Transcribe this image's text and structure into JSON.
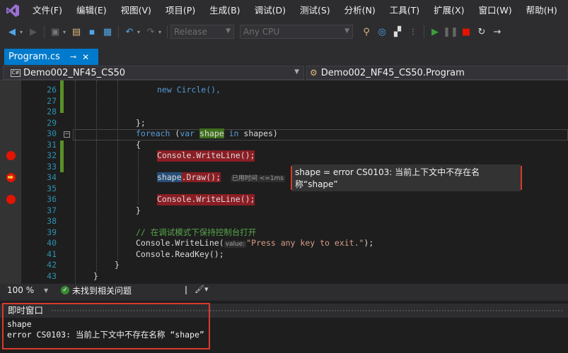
{
  "menubar": {
    "items": [
      "文件(F)",
      "编辑(E)",
      "视图(V)",
      "项目(P)",
      "生成(B)",
      "调试(D)",
      "测试(S)",
      "分析(N)",
      "工具(T)",
      "扩展(X)",
      "窗口(W)",
      "帮助(H)"
    ]
  },
  "toolbar": {
    "configuration": "Release",
    "platform": "Any CPU"
  },
  "tab": {
    "title": "Program.cs",
    "pin_icon": "pin-icon",
    "close_icon": "close-icon"
  },
  "navbar": {
    "project": "Demo002_NF45_CS50",
    "class": "Demo002_NF45_CS50.Program"
  },
  "editor": {
    "lines": {
      "l26": "new Circle(),",
      "l29": "};",
      "l30_kw1": "foreach",
      "l30_a": " (",
      "l30_kw2": "var",
      "l30_var": "shape",
      "l30_kw3": "in",
      "l30_b": " shapes)",
      "l31": "{",
      "l32": "Console.WriteLine();",
      "l34_var": "shape",
      "l34_call": ".Draw();",
      "l34_hint": "已用时间 <=1ms",
      "l36": "Console.WriteLine();",
      "l37": "}",
      "l39": "// 在调试模式下保持控制台打开",
      "l40_a": "Console.WriteLine(",
      "l40_hint": "value:",
      "l40_str": "\"Press any key to exit.\"",
      "l40_b": ");",
      "l41": "Console.ReadKey();",
      "l42": "}",
      "l43": "}"
    },
    "line_numbers": [
      "26",
      "27",
      "28",
      "29",
      "30",
      "31",
      "32",
      "33",
      "34",
      "35",
      "36",
      "37",
      "38",
      "39",
      "40",
      "41",
      "42",
      "43"
    ],
    "datatip": "shape = error CS0103: 当前上下文中不存在名称“shape”"
  },
  "footer": {
    "zoom": "100 %",
    "issues": "未找到相关问题"
  },
  "immediate": {
    "title": "即时窗口",
    "output_line1": "shape",
    "output_line2": "error CS0103: 当前上下文中不存在名称 “shape”"
  },
  "colors": {
    "accent": "#007acc",
    "breakpoint": "#e51400",
    "highlight_border": "#d83b2d"
  }
}
